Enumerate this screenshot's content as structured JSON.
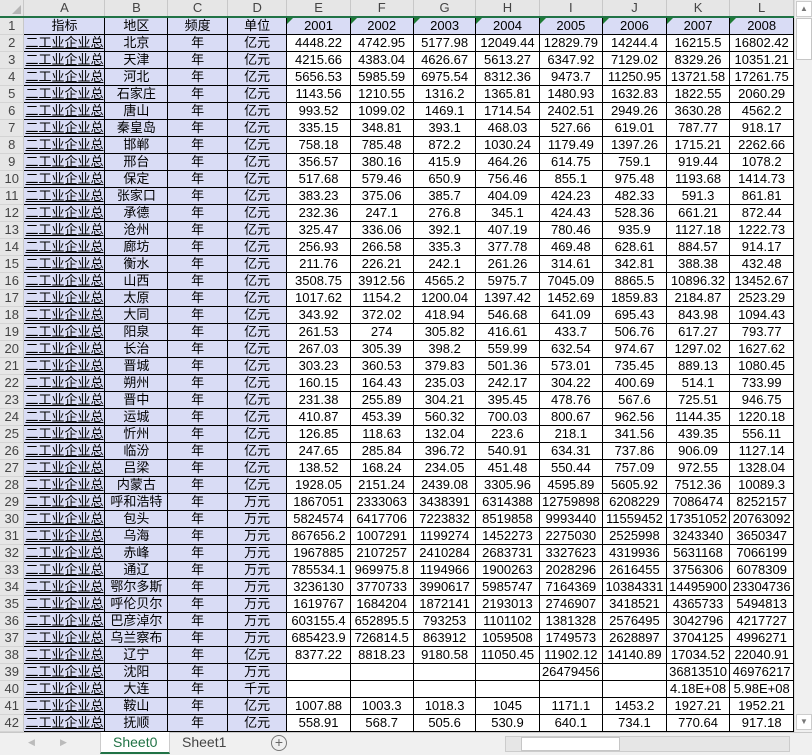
{
  "columns": [
    "A",
    "B",
    "C",
    "D",
    "E",
    "F",
    "G",
    "H",
    "I",
    "J",
    "K",
    "L"
  ],
  "header": [
    "指标",
    "地区",
    "频度",
    "单位",
    "2001",
    "2002",
    "2003",
    "2004",
    "2005",
    "2006",
    "2007",
    "2008"
  ],
  "indicator_text": "二工业企业总",
  "frequency": "年",
  "rows": [
    [
      "北京",
      "亿元",
      "4448.22",
      "4742.95",
      "5177.98",
      "12049.44",
      "12829.79",
      "14244.4",
      "16215.5",
      "16802.42"
    ],
    [
      "天津",
      "亿元",
      "4215.66",
      "4383.04",
      "4626.67",
      "5613.27",
      "6347.92",
      "7129.02",
      "8329.26",
      "10351.21"
    ],
    [
      "河北",
      "亿元",
      "5656.53",
      "5985.59",
      "6975.54",
      "8312.36",
      "9473.7",
      "11250.95",
      "13721.58",
      "17261.75"
    ],
    [
      "石家庄",
      "亿元",
      "1143.56",
      "1210.55",
      "1316.2",
      "1365.81",
      "1480.93",
      "1632.83",
      "1822.55",
      "2060.29"
    ],
    [
      "唐山",
      "亿元",
      "993.52",
      "1099.02",
      "1469.1",
      "1714.54",
      "2402.51",
      "2949.26",
      "3630.28",
      "4562.2"
    ],
    [
      "秦皇岛",
      "亿元",
      "335.15",
      "348.81",
      "393.1",
      "468.03",
      "527.66",
      "619.01",
      "787.77",
      "918.17"
    ],
    [
      "邯郸",
      "亿元",
      "758.18",
      "785.48",
      "872.2",
      "1030.24",
      "1179.49",
      "1397.26",
      "1715.21",
      "2262.66"
    ],
    [
      "邢台",
      "亿元",
      "356.57",
      "380.16",
      "415.9",
      "464.26",
      "614.75",
      "759.1",
      "919.44",
      "1078.2"
    ],
    [
      "保定",
      "亿元",
      "517.68",
      "579.46",
      "650.9",
      "756.46",
      "855.1",
      "975.48",
      "1193.68",
      "1414.73"
    ],
    [
      "张家口",
      "亿元",
      "383.23",
      "375.06",
      "385.7",
      "404.09",
      "424.23",
      "482.33",
      "591.3",
      "861.81"
    ],
    [
      "承德",
      "亿元",
      "232.36",
      "247.1",
      "276.8",
      "345.1",
      "424.43",
      "528.36",
      "661.21",
      "872.44"
    ],
    [
      "沧州",
      "亿元",
      "325.47",
      "336.06",
      "392.1",
      "407.19",
      "780.46",
      "935.9",
      "1127.18",
      "1222.73"
    ],
    [
      "廊坊",
      "亿元",
      "256.93",
      "266.58",
      "335.3",
      "377.78",
      "469.48",
      "628.61",
      "884.57",
      "914.17"
    ],
    [
      "衡水",
      "亿元",
      "211.76",
      "226.21",
      "242.1",
      "261.26",
      "314.61",
      "342.81",
      "388.38",
      "432.48"
    ],
    [
      "山西",
      "亿元",
      "3508.75",
      "3912.56",
      "4565.2",
      "5975.7",
      "7045.09",
      "8865.5",
      "10896.32",
      "13452.67"
    ],
    [
      "太原",
      "亿元",
      "1017.62",
      "1154.2",
      "1200.04",
      "1397.42",
      "1452.69",
      "1859.83",
      "2184.87",
      "2523.29"
    ],
    [
      "大同",
      "亿元",
      "343.92",
      "372.02",
      "418.94",
      "546.68",
      "641.09",
      "695.43",
      "843.98",
      "1094.43"
    ],
    [
      "阳泉",
      "亿元",
      "261.53",
      "274",
      "305.82",
      "416.61",
      "433.7",
      "506.76",
      "617.27",
      "793.77"
    ],
    [
      "长治",
      "亿元",
      "267.03",
      "305.39",
      "398.2",
      "559.99",
      "632.54",
      "974.67",
      "1297.02",
      "1627.62"
    ],
    [
      "晋城",
      "亿元",
      "303.23",
      "360.53",
      "379.83",
      "501.36",
      "573.01",
      "735.45",
      "889.13",
      "1080.45"
    ],
    [
      "朔州",
      "亿元",
      "160.15",
      "164.43",
      "235.03",
      "242.17",
      "304.22",
      "400.69",
      "514.1",
      "733.99"
    ],
    [
      "晋中",
      "亿元",
      "231.38",
      "255.89",
      "304.21",
      "395.45",
      "478.76",
      "567.6",
      "725.51",
      "946.75"
    ],
    [
      "运城",
      "亿元",
      "410.87",
      "453.39",
      "560.32",
      "700.03",
      "800.67",
      "962.56",
      "1144.35",
      "1220.18"
    ],
    [
      "忻州",
      "亿元",
      "126.85",
      "118.63",
      "132.04",
      "223.6",
      "218.1",
      "341.56",
      "439.35",
      "556.11"
    ],
    [
      "临汾",
      "亿元",
      "247.65",
      "285.84",
      "396.72",
      "540.91",
      "634.31",
      "737.86",
      "906.09",
      "1127.14"
    ],
    [
      "吕梁",
      "亿元",
      "138.52",
      "168.24",
      "234.05",
      "451.48",
      "550.44",
      "757.09",
      "972.55",
      "1328.04"
    ],
    [
      "内蒙古",
      "亿元",
      "1928.05",
      "2151.24",
      "2439.08",
      "3305.96",
      "4595.89",
      "5605.92",
      "7512.36",
      "10089.3"
    ],
    [
      "呼和浩特",
      "万元",
      "1867051",
      "2333063",
      "3438391",
      "6314388",
      "12759898",
      "6208229",
      "7086474",
      "8252157"
    ],
    [
      "包头",
      "万元",
      "5824574",
      "6417706",
      "7223832",
      "8519858",
      "9993440",
      "11559452",
      "17351052",
      "20763092"
    ],
    [
      "乌海",
      "万元",
      "867656.2",
      "1007291",
      "1199274",
      "1452273",
      "2275030",
      "2525998",
      "3243340",
      "3650347"
    ],
    [
      "赤峰",
      "万元",
      "1967885",
      "2107257",
      "2410284",
      "2683731",
      "3327623",
      "4319936",
      "5631168",
      "7066199"
    ],
    [
      "通辽",
      "万元",
      "785534.1",
      "969975.8",
      "1194966",
      "1900263",
      "2028296",
      "2616455",
      "3756306",
      "6078309"
    ],
    [
      "鄂尔多斯",
      "万元",
      "3236130",
      "3770733",
      "3990617",
      "5985747",
      "7164369",
      "10384331",
      "14495900",
      "23304736"
    ],
    [
      "呼伦贝尔",
      "万元",
      "1619767",
      "1684204",
      "1872141",
      "2193013",
      "2746907",
      "3418521",
      "4365733",
      "5494813"
    ],
    [
      "巴彦淖尔",
      "万元",
      "603155.4",
      "652895.5",
      "793253",
      "1101102",
      "1381328",
      "2576495",
      "3042796",
      "4217727"
    ],
    [
      "乌兰察布",
      "万元",
      "685423.9",
      "726814.5",
      "863912",
      "1059508",
      "1749573",
      "2628897",
      "3704125",
      "4996271"
    ],
    [
      "辽宁",
      "亿元",
      "8377.22",
      "8818.23",
      "9180.58",
      "11050.45",
      "11902.12",
      "14140.89",
      "17034.52",
      "22040.91"
    ],
    [
      "沈阳",
      "万元",
      "",
      "",
      "",
      "",
      "26479456",
      "",
      "36813510",
      "46976217"
    ],
    [
      "大连",
      "千元",
      "",
      "",
      "",
      "",
      "",
      "",
      "4.18E+08",
      "5.98E+08"
    ],
    [
      "鞍山",
      "亿元",
      "1007.88",
      "1003.3",
      "1018.3",
      "1045",
      "1171.1",
      "1453.2",
      "1927.21",
      "1952.21"
    ],
    [
      "抚顺",
      "亿元",
      "558.91",
      "568.7",
      "505.6",
      "530.9",
      "640.1",
      "734.1",
      "770.64",
      "917.18"
    ]
  ],
  "sheets": [
    "Sheet0",
    "Sheet1"
  ],
  "active_sheet": "Sheet0"
}
